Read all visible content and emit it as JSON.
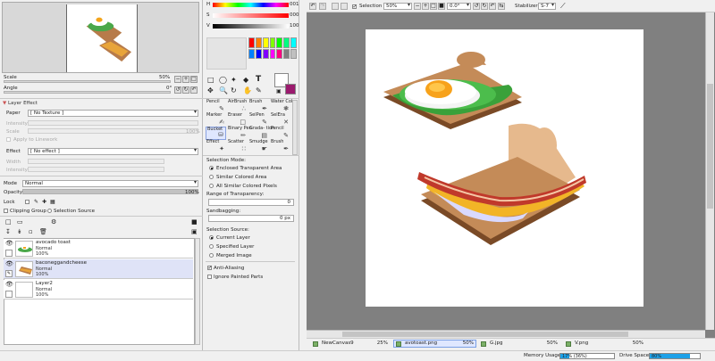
{
  "navigator": {
    "scale_label": "Scale",
    "scale_value": "50%",
    "angle_label": "Angle",
    "angle_value": "0°"
  },
  "color": {
    "h_label": "H",
    "h_value": "001",
    "s_label": "S",
    "s_value": "000",
    "v_label": "V",
    "v_value": "100",
    "swatches": [
      "#ff0000",
      "#ff8000",
      "#ffff00",
      "#80ff00",
      "#00ff00",
      "#00ff80",
      "#00ffff",
      "#0080ff",
      "#0000ff",
      "#8000ff",
      "#ff00ff",
      "#ff0080",
      "#808080",
      "#c0c0c0"
    ],
    "fg": "#ffffff",
    "bg": "#9b1b6e"
  },
  "layer_effect": {
    "title": "Layer Effect",
    "paper_label": "Paper",
    "paper_value": "[ No Texture ]",
    "intensity_label": "Intensity",
    "scale_label": "Scale",
    "scale_value": "100%",
    "apply_label": "Apply to Linework",
    "effect_label": "Effect",
    "effect_value": "[ No effect ]",
    "width_label": "Width",
    "intensity2_label": "Intensity"
  },
  "layer": {
    "mode_label": "Mode",
    "mode_value": "Normal",
    "opacity_label": "Opacity",
    "opacity_value": "100%",
    "opacity_fraction": 1.0,
    "lock_label": "Lock",
    "clipping_label": "Clipping Group",
    "selection_source_label": "Selection Source",
    "items": [
      {
        "name": "avocado toast",
        "mode": "Normal",
        "opacity": "100%"
      },
      {
        "name": "baconeggandcheese",
        "mode": "Normal",
        "opacity": "100%"
      },
      {
        "name": "Layer2",
        "mode": "Normal",
        "opacity": "100%"
      }
    ]
  },
  "tools": [
    {
      "name": "Pencil",
      "icon": "pencil-icon"
    },
    {
      "name": "AirBrush",
      "icon": "airbrush-icon"
    },
    {
      "name": "Brush",
      "icon": "brush-icon"
    },
    {
      "name": "Water Color",
      "icon": "watercolor-icon"
    },
    {
      "name": "Marker",
      "icon": "marker-icon"
    },
    {
      "name": "Eraser",
      "icon": "eraser-icon"
    },
    {
      "name": "SelPen",
      "icon": "selpen-icon"
    },
    {
      "name": "SelEra",
      "icon": "selera-icon"
    },
    {
      "name": "Bucket",
      "icon": "bucket-icon"
    },
    {
      "name": "Binary Pen",
      "icon": "binary-pen-icon"
    },
    {
      "name": "Grada- tion",
      "icon": "gradation-icon"
    },
    {
      "name": "Pencil",
      "icon": "pencil-icon"
    },
    {
      "name": "Effect",
      "icon": "effect-icon"
    },
    {
      "name": "Scatter",
      "icon": "scatter-icon"
    },
    {
      "name": "Smudge",
      "icon": "smudge-icon"
    },
    {
      "name": "Brush",
      "icon": "brush-icon"
    }
  ],
  "tool_options": {
    "selection_mode_label": "Selection Mode:",
    "mode_options": [
      "Enclosed Transparent Area",
      "Similar Colored Area",
      "All Similar Colored Pixels"
    ],
    "range_label": "Range of Transparency:",
    "range_value": "0",
    "sandbagging_label": "Sandbagging:",
    "sandbagging_value": "0 px",
    "selection_source_label": "Selection Source:",
    "source_options": [
      "Current Layer",
      "Specified Layer",
      "Merged Image"
    ],
    "anti_aliasing_label": "Anti-Aliasing",
    "ignore_label": "Ignore Painted Parts"
  },
  "toolbar": {
    "selection_label": "Selection",
    "zoom_value": "50%",
    "angle_value": "0.0°",
    "stabilizer_label": "Stabilizer",
    "stabilizer_value": "S-7"
  },
  "tabs": [
    {
      "name": "NewCanvas9",
      "zoom": "25%"
    },
    {
      "name": "avotoast.png",
      "zoom": "50%"
    },
    {
      "name": "G.jpg",
      "zoom": "50%"
    },
    {
      "name": "V.png",
      "zoom": "50%"
    }
  ],
  "status": {
    "memory_label": "Memory Usage",
    "memory_value": "17% (36%)",
    "memory_fraction": 0.17,
    "drive_label": "Drive Space",
    "drive_value": "80%",
    "drive_fraction": 0.8
  }
}
